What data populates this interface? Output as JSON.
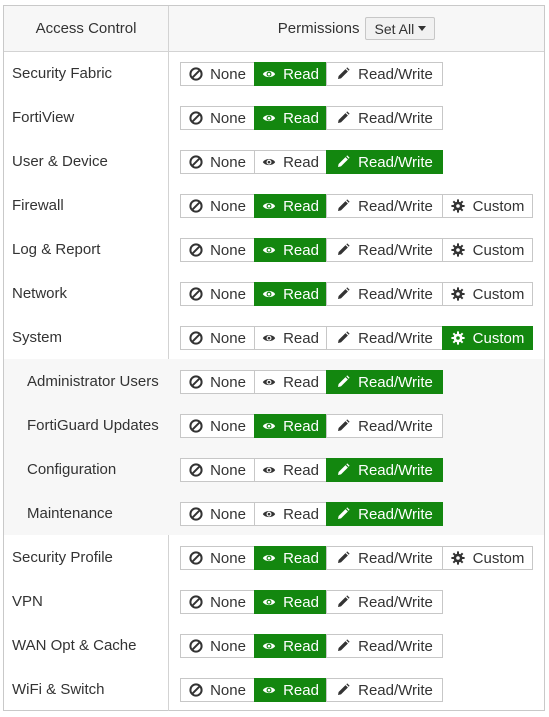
{
  "header": {
    "access_control": "Access Control",
    "permissions": "Permissions",
    "set_all": "Set All"
  },
  "buttons": {
    "none": "None",
    "read": "Read",
    "read_write": "Read/Write",
    "custom": "Custom"
  },
  "icons": {
    "none": "ban-icon",
    "read": "eye-icon",
    "read_write": "pencil-icon",
    "custom": "gear-icon"
  },
  "colors": {
    "selected": "#13870f",
    "subrow_bg": "#f7f7f7",
    "border": "#c7c7c7"
  },
  "rows": [
    {
      "label": "Security Fabric",
      "options": [
        "none",
        "read",
        "read_write"
      ],
      "selected": "read",
      "sub": false
    },
    {
      "label": "FortiView",
      "options": [
        "none",
        "read",
        "read_write"
      ],
      "selected": "read",
      "sub": false
    },
    {
      "label": "User & Device",
      "options": [
        "none",
        "read",
        "read_write"
      ],
      "selected": "read_write",
      "sub": false
    },
    {
      "label": "Firewall",
      "options": [
        "none",
        "read",
        "read_write",
        "custom"
      ],
      "selected": "read",
      "sub": false
    },
    {
      "label": "Log & Report",
      "options": [
        "none",
        "read",
        "read_write",
        "custom"
      ],
      "selected": "read",
      "sub": false
    },
    {
      "label": "Network",
      "options": [
        "none",
        "read",
        "read_write",
        "custom"
      ],
      "selected": "read",
      "sub": false
    },
    {
      "label": "System",
      "options": [
        "none",
        "read",
        "read_write",
        "custom"
      ],
      "selected": "custom",
      "sub": false
    },
    {
      "label": "Administrator Users",
      "options": [
        "none",
        "read",
        "read_write"
      ],
      "selected": "read_write",
      "sub": true
    },
    {
      "label": "FortiGuard Updates",
      "options": [
        "none",
        "read",
        "read_write"
      ],
      "selected": "read",
      "sub": true
    },
    {
      "label": "Configuration",
      "options": [
        "none",
        "read",
        "read_write"
      ],
      "selected": "read_write",
      "sub": true
    },
    {
      "label": "Maintenance",
      "options": [
        "none",
        "read",
        "read_write"
      ],
      "selected": "read_write",
      "sub": true
    },
    {
      "label": "Security Profile",
      "options": [
        "none",
        "read",
        "read_write",
        "custom"
      ],
      "selected": "read",
      "sub": false
    },
    {
      "label": "VPN",
      "options": [
        "none",
        "read",
        "read_write"
      ],
      "selected": "read",
      "sub": false
    },
    {
      "label": "WAN Opt & Cache",
      "options": [
        "none",
        "read",
        "read_write"
      ],
      "selected": "read",
      "sub": false
    },
    {
      "label": "WiFi & Switch",
      "options": [
        "none",
        "read",
        "read_write"
      ],
      "selected": "read",
      "sub": false
    }
  ]
}
